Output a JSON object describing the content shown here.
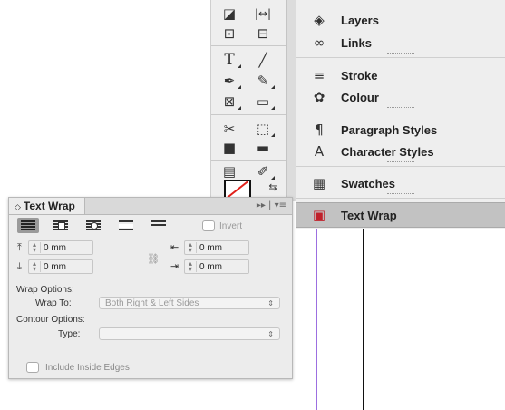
{
  "panels": [
    {
      "label": "Layers",
      "icon": "layers-icon",
      "glyph": "◈"
    },
    {
      "label": "Links",
      "icon": "links-icon",
      "glyph": "∞"
    },
    {
      "label": "Stroke",
      "icon": "stroke-icon",
      "glyph": "≡"
    },
    {
      "label": "Colour",
      "icon": "colour-icon",
      "glyph": "✿"
    },
    {
      "label": "Paragraph Styles",
      "icon": "paragraph-styles-icon",
      "glyph": "¶"
    },
    {
      "label": "Character Styles",
      "icon": "character-styles-icon",
      "glyph": "A"
    },
    {
      "label": "Swatches",
      "icon": "swatches-icon",
      "glyph": "▦"
    },
    {
      "label": "Text Wrap",
      "icon": "text-wrap-icon",
      "glyph": "▣"
    }
  ],
  "tools": [
    {
      "name": "page-tool-icon",
      "glyph": "◪"
    },
    {
      "name": "gap-tool-icon",
      "glyph": "|↔|"
    },
    {
      "name": "content-collector-icon",
      "glyph": "⊡"
    },
    {
      "name": "content-placer-icon",
      "glyph": "⊟"
    },
    {
      "name": "type-tool-icon",
      "glyph": "T"
    },
    {
      "name": "line-tool-icon",
      "glyph": "╱"
    },
    {
      "name": "pen-tool-icon",
      "glyph": "✒"
    },
    {
      "name": "pencil-tool-icon",
      "glyph": "✎"
    },
    {
      "name": "rectangle-frame-tool-icon",
      "glyph": "⊠"
    },
    {
      "name": "rectangle-tool-icon",
      "glyph": "▭"
    },
    {
      "name": "scissors-tool-icon",
      "glyph": "✂"
    },
    {
      "name": "free-transform-tool-icon",
      "glyph": "⬚"
    },
    {
      "name": "gradient-swatch-tool-icon",
      "glyph": "■"
    },
    {
      "name": "gradient-feather-tool-icon",
      "glyph": "▬"
    },
    {
      "name": "note-tool-icon",
      "glyph": "▤"
    },
    {
      "name": "eyedropper-tool-icon",
      "glyph": "✐"
    },
    {
      "name": "hand-tool-icon",
      "glyph": "☚"
    },
    {
      "name": "zoom-tool-icon",
      "glyph": "⌕"
    }
  ],
  "text_wrap": {
    "title": "Text Wrap",
    "title_glyph": "◇",
    "menu_glyphs": "▸▸ | ▾≡",
    "invert_label": "Invert",
    "top_offset": "0 mm",
    "bottom_offset": "0 mm",
    "left_offset": "0 mm",
    "right_offset": "0 mm",
    "wrap_options_label": "Wrap Options:",
    "wrap_to_label": "Wrap To:",
    "wrap_to_value": "Both Right & Left Sides",
    "contour_options_label": "Contour Options:",
    "type_label": "Type:",
    "type_value": "",
    "include_inside_edges_label": "Include Inside Edges"
  },
  "colors": {
    "active_panel": "#c2c2c2",
    "guide_purple": "#9c6fe0",
    "no_fill_slash": "#e0201a"
  }
}
